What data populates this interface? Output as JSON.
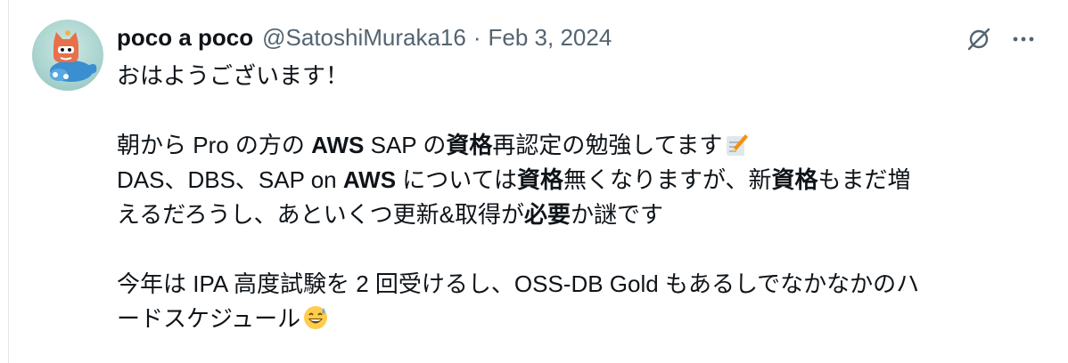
{
  "tweet": {
    "author": {
      "display_name": "poco a poco",
      "handle": "@SatoshiMuraka16",
      "separator": "·",
      "date": "Feb 3, 2024"
    },
    "lines": {
      "l1": "おはようございます！",
      "l2": [
        "朝から Pro の方の ",
        "AWS",
        " SAP の",
        "資格",
        "再認定の勉強してます"
      ],
      "l3": [
        "DAS、DBS、SAP on ",
        "AWS",
        " については",
        "資格",
        "無くなりますが、新",
        "資格",
        "もまだ増"
      ],
      "l4": [
        "えるだろうし、あといくつ更新&取得が",
        "必要",
        "か謎です"
      ],
      "l5": "今年は IPA 高度試験を 2 回受けるし、OSS-DB Gold もあるしでなかなかのハ",
      "l6": "ードスケジュール"
    },
    "emojis": {
      "memo": "memo-emoji",
      "sweat_smile": "grinning-sweat-emoji"
    },
    "icons": {
      "grok": "grok-icon",
      "more": "more-icon"
    },
    "colors": {
      "text": "#0f1419",
      "secondary": "#536471",
      "border": "#e6e6e6"
    }
  }
}
